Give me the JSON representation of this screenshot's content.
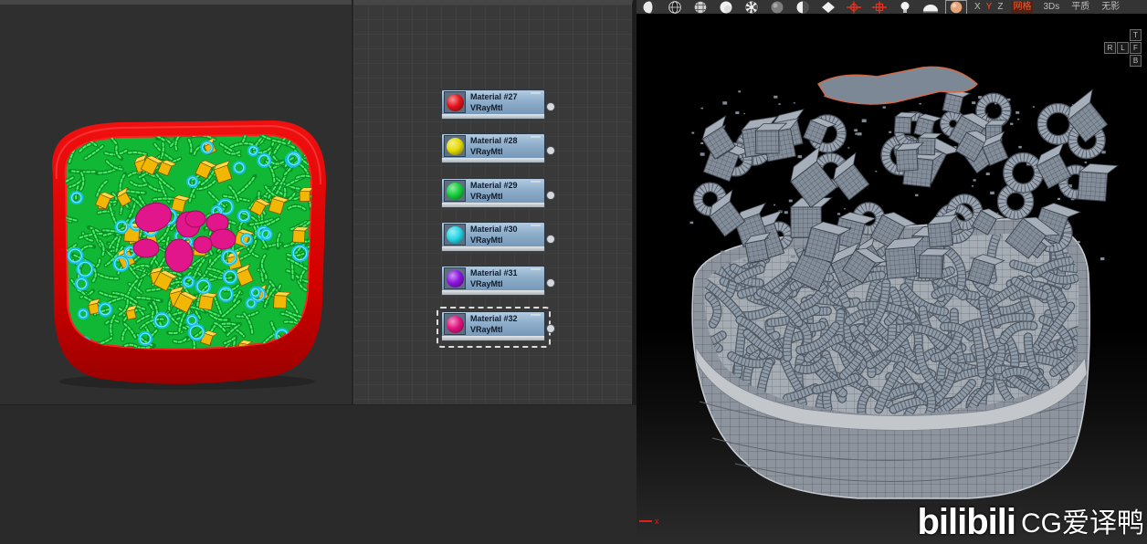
{
  "node_editor": {
    "collapse_symbol": "—",
    "nodes": [
      {
        "title": "Material #27",
        "type": "VRayMtl",
        "swatch_color": "#e3121a",
        "selected": false
      },
      {
        "title": "Material #28",
        "type": "VRayMtl",
        "swatch_color": "#e6dc00",
        "selected": false
      },
      {
        "title": "Material #29",
        "type": "VRayMtl",
        "swatch_color": "#14cf3a",
        "selected": false
      },
      {
        "title": "Material #30",
        "type": "VRayMtl",
        "swatch_color": "#27d6e6",
        "selected": false
      },
      {
        "title": "Material #31",
        "type": "VRayMtl",
        "swatch_color": "#8c14e0",
        "selected": false
      },
      {
        "title": "Material #32",
        "type": "VRayMtl",
        "swatch_color": "#e0147e",
        "selected": true
      }
    ]
  },
  "viewport": {
    "toolbar": {
      "icons": [
        "shaded-sphere",
        "wireframe-sphere",
        "grid-sphere",
        "white-sphere",
        "checker-sphere",
        "dark-sphere",
        "half-sphere",
        "flat-shape",
        "move-gizmo",
        "scale-gizmo",
        "light-bulb",
        "dome",
        "matcap-sphere"
      ],
      "boxed_icon": "matcap-sphere",
      "axes": [
        "X",
        "Y",
        "Z"
      ],
      "active_axis": "Y",
      "buttons": [
        "网格",
        "3Ds",
        "平质",
        "无影"
      ],
      "active_button": "网格"
    },
    "view_cube": {
      "top": "T",
      "row": [
        "R",
        "L",
        "F"
      ],
      "bottom": "B"
    },
    "axis_indicator": "x"
  },
  "colors": {
    "bowl_red": "#d40000",
    "pasta_green": "#12c63a",
    "cube_yellow": "#f2b705",
    "ring_cyan": "#14c0e8",
    "flower_magenta": "#e0168a",
    "mesh_gray": "#8f969f",
    "accent_red": "#e0201a"
  },
  "watermark": {
    "logo": "bilibili",
    "channel": "CG爱译鸭"
  }
}
